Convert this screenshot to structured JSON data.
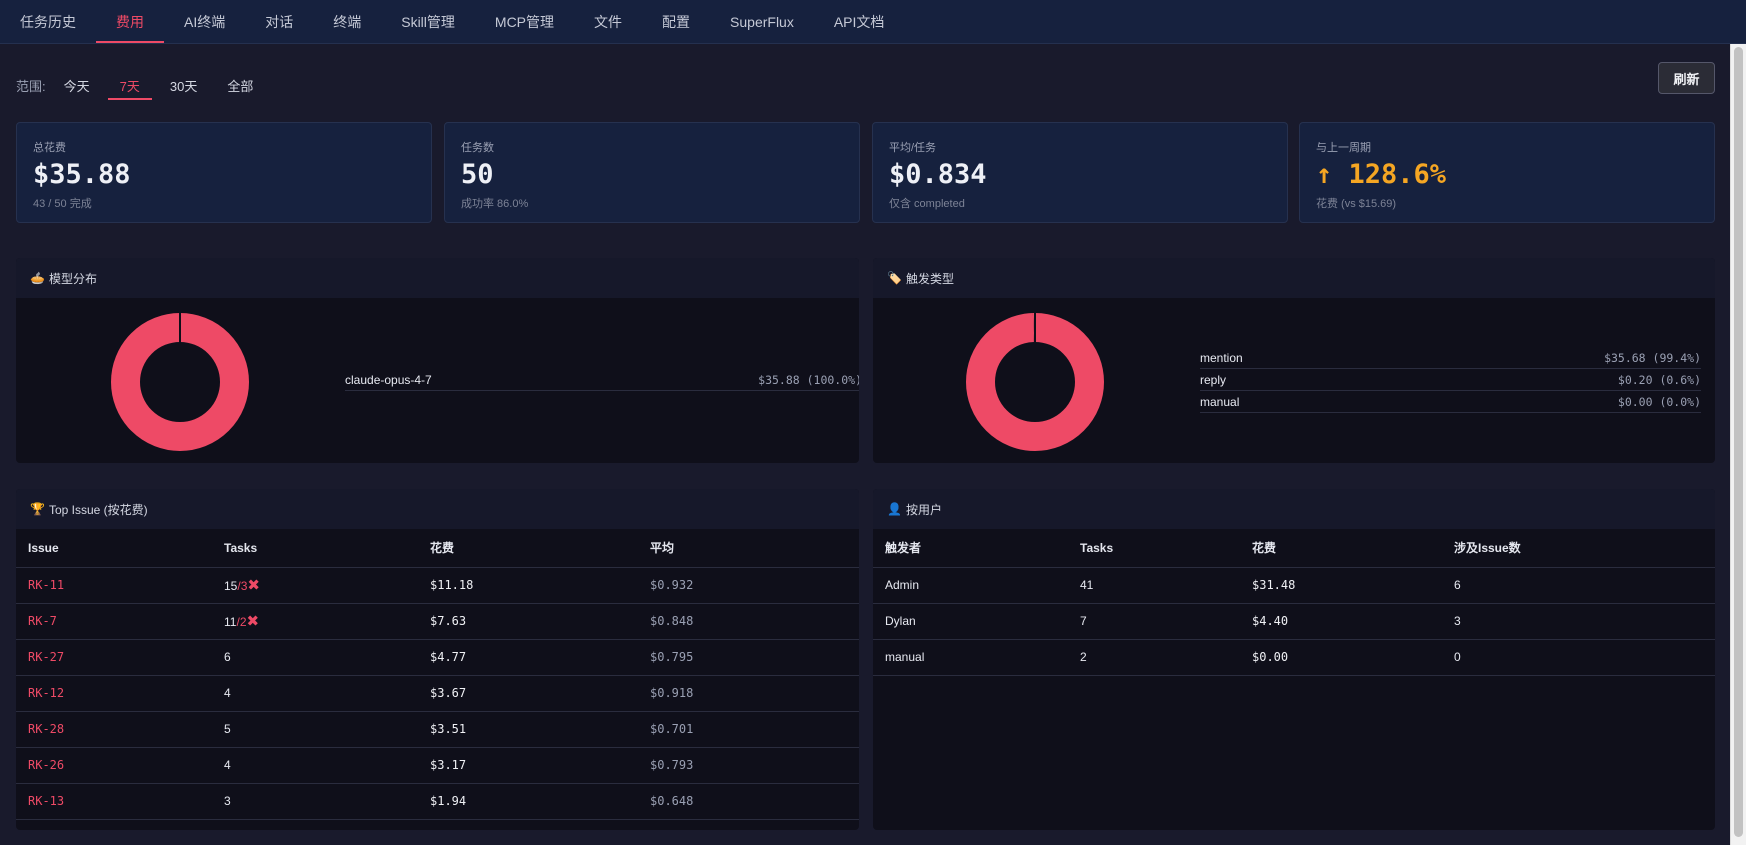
{
  "nav": {
    "tabs": [
      {
        "label": "任务历史"
      },
      {
        "label": "费用",
        "active": true
      },
      {
        "label": "AI终端"
      },
      {
        "label": "对话"
      },
      {
        "label": "终端"
      },
      {
        "label": "Skill管理"
      },
      {
        "label": "MCP管理"
      },
      {
        "label": "文件"
      },
      {
        "label": "配置"
      },
      {
        "label": "SuperFlux"
      },
      {
        "label": "API文档"
      }
    ]
  },
  "range": {
    "label": "范围:",
    "options": [
      {
        "label": "今天"
      },
      {
        "label": "7天",
        "active": true
      },
      {
        "label": "30天"
      },
      {
        "label": "全部"
      }
    ]
  },
  "refresh_label": "刷新",
  "cards": [
    {
      "label": "总花费",
      "value": "$35.88",
      "sub": "43 / 50 完成"
    },
    {
      "label": "任务数",
      "value": "50",
      "sub": "成功率 86.0%"
    },
    {
      "label": "平均/任务",
      "value": "$0.834",
      "sub": "仅含 completed"
    },
    {
      "label": "与上一周期",
      "value": "↑ 128.6%",
      "sub": "花费 (vs $15.69)"
    }
  ],
  "colors": {
    "accent": "#ee4a66",
    "warn": "#f5a623"
  },
  "model_panel": {
    "icon": "pie-icon",
    "title": "模型分布",
    "items": [
      {
        "name": "claude-opus-4-7",
        "value": "$35.88 (100.0%)",
        "fraction": 1.0
      }
    ]
  },
  "trigger_panel": {
    "icon": "tag-icon",
    "title": "触发类型",
    "items": [
      {
        "name": "mention",
        "value": "$35.68 (99.4%)",
        "fraction": 0.994
      },
      {
        "name": "reply",
        "value": "$0.20 (0.6%)",
        "fraction": 0.006
      },
      {
        "name": "manual",
        "value": "$0.00 (0.0%)",
        "fraction": 0.0
      }
    ]
  },
  "issue_panel": {
    "icon": "trophy-icon",
    "title": "Top Issue (按花费)",
    "headers": [
      "Issue",
      "Tasks",
      "花费",
      "平均"
    ],
    "rows": [
      {
        "issue": "RK-11",
        "tasks": "15",
        "failed": "3",
        "cost": "$11.18",
        "avg": "$0.932"
      },
      {
        "issue": "RK-7",
        "tasks": "11",
        "failed": "2",
        "cost": "$7.63",
        "avg": "$0.848"
      },
      {
        "issue": "RK-27",
        "tasks": "6",
        "failed": "",
        "cost": "$4.77",
        "avg": "$0.795"
      },
      {
        "issue": "RK-12",
        "tasks": "4",
        "failed": "",
        "cost": "$3.67",
        "avg": "$0.918"
      },
      {
        "issue": "RK-28",
        "tasks": "5",
        "failed": "",
        "cost": "$3.51",
        "avg": "$0.701"
      },
      {
        "issue": "RK-26",
        "tasks": "4",
        "failed": "",
        "cost": "$3.17",
        "avg": "$0.793"
      },
      {
        "issue": "RK-13",
        "tasks": "3",
        "failed": "",
        "cost": "$1.94",
        "avg": "$0.648"
      }
    ]
  },
  "user_panel": {
    "icon": "user-icon",
    "title": "按用户",
    "headers": [
      "触发者",
      "Tasks",
      "花费",
      "涉及Issue数"
    ],
    "rows": [
      {
        "user": "Admin",
        "tasks": "41",
        "cost": "$31.48",
        "issues": "6"
      },
      {
        "user": "Dylan",
        "tasks": "7",
        "cost": "$4.40",
        "issues": "3"
      },
      {
        "user": "manual",
        "tasks": "2",
        "cost": "$0.00",
        "issues": "0"
      }
    ]
  }
}
